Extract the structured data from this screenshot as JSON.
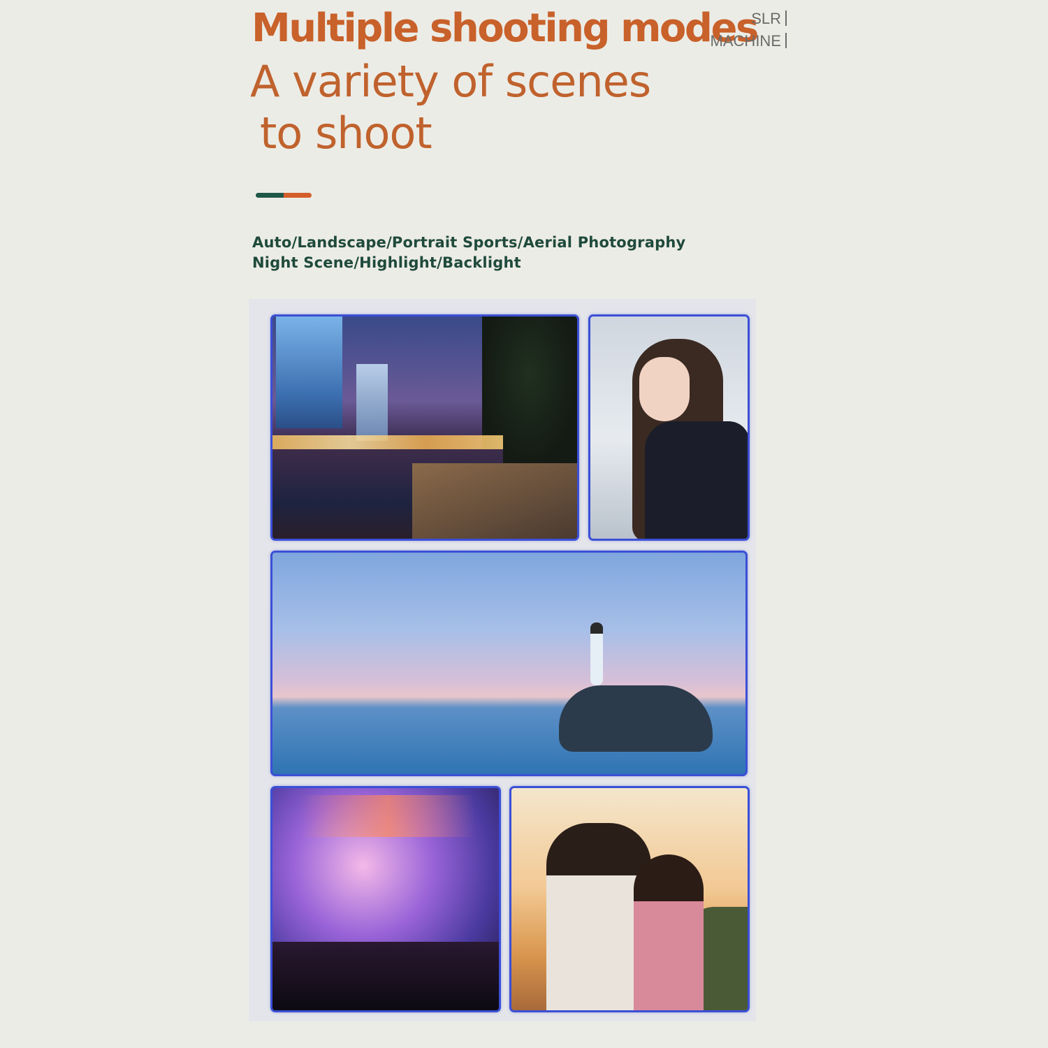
{
  "header": {
    "title": "Multiple shooting modes",
    "tag_line1": "SLR",
    "tag_line2": "MACHINE",
    "subtitle_line1": "A variety of scenes",
    "subtitle_line2": "to shoot"
  },
  "modes": {
    "line1": "Auto/Landscape/Portrait Sports/Aerial Photography",
    "line2": "Night Scene/Highlight/Backlight"
  },
  "colors": {
    "title": "#c8612a",
    "divider_left": "#1f5748",
    "divider_right": "#d45f2a",
    "modes_text": "#1f4a3c",
    "photo_border": "#3b4fd6"
  },
  "photos": [
    "night-city-photo",
    "portrait-photo",
    "seascape-photo",
    "concert-photo",
    "couple-sunset-photo"
  ]
}
